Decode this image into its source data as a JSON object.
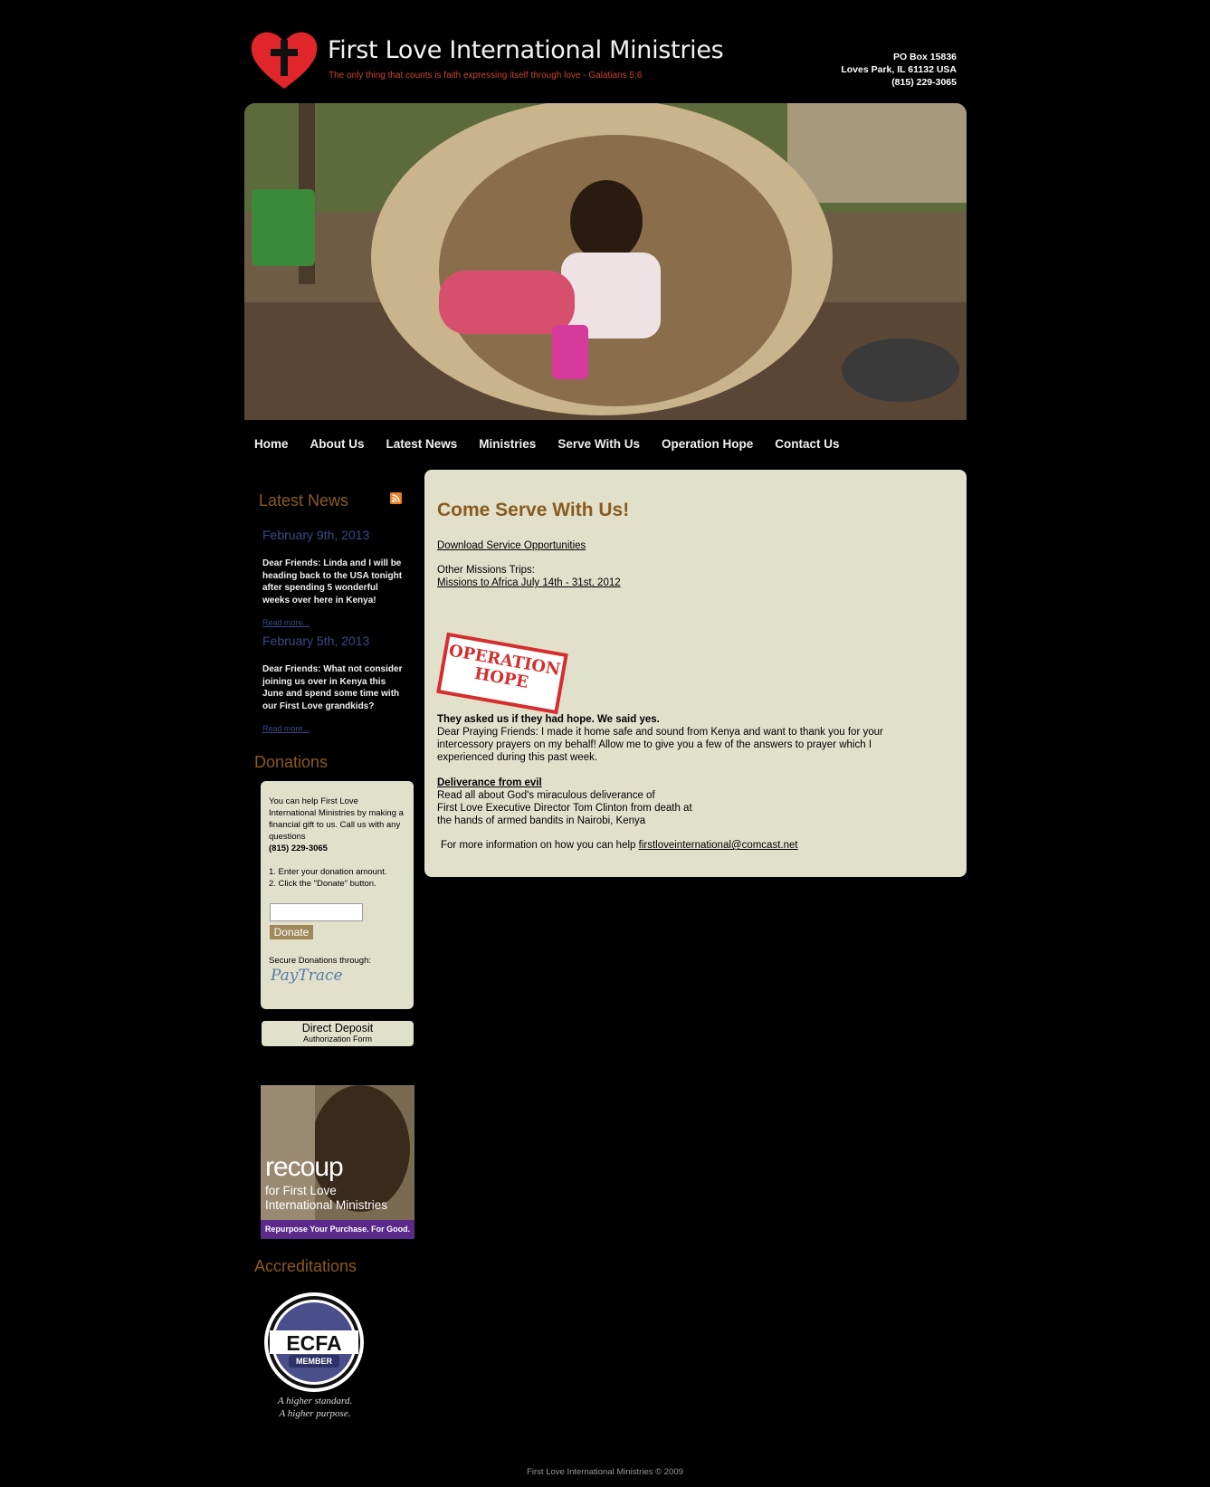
{
  "header": {
    "title": "First Love International Ministries",
    "tagline": "The only thing that counts is faith expressing itself through love - Galatians 5:6",
    "address": [
      "PO Box 15836",
      "Loves Park, IL 61132 USA",
      "(815) 229-3065"
    ]
  },
  "nav": {
    "items": [
      "Home",
      "About Us",
      "Latest News",
      "Ministries",
      "Serve With Us",
      "Operation Hope",
      "Contact Us"
    ]
  },
  "sidebar": {
    "latest_news_heading": "Latest News",
    "news": [
      {
        "date": "February 9th, 2013",
        "text": "Dear Friends: Linda and I will be heading back to the USA tonight after spending 5 wonderful weeks over here in Kenya!",
        "more": "Read more..."
      },
      {
        "date": "February 5th, 2013",
        "text": "Dear Friends: What not consider joining us over in Kenya this June and spend some time with our First Love grandkids?",
        "more": "Read more..."
      }
    ],
    "donations_heading": "Donations",
    "donation_text": "You can help First Love International Ministries by making a financial gift to us. Call us with any questions",
    "donation_phone": "(815) 229-3065",
    "donation_step1": "1. Enter your donation amount.",
    "donation_step2": "2. Click the \"Donate\" button.",
    "donate_button": "Donate",
    "secure_text": "Secure Donations through:",
    "paytrace": "PayTrace",
    "direct_deposit_title": "Direct Deposit",
    "direct_deposit_sub": "Authorization Form",
    "recoup_word": "recoup",
    "recoup_sub1": "for First Love",
    "recoup_sub2": "International Ministries",
    "recoup_bar": "Repurpose Your Purchase. For Good.",
    "accreditations_heading": "Accreditations",
    "ecfa_name": "ECFA",
    "ecfa_member": "MEMBER",
    "ecfa_tag1": "A higher standard.",
    "ecfa_tag2": "A higher purpose."
  },
  "main": {
    "title": "Come Serve With Us!",
    "download_link": "Download Service Opportunities",
    "other_trips": "Other Missions Trips:",
    "africa_link": "Missions to Africa July 14th - 31st, 2012",
    "op_hope_line1": "OPERATION",
    "op_hope_line2": "HOPE",
    "hope_heading": "They asked us if they had hope.  We said yes.",
    "hope_body": [
      "Dear Praying Friends:  I made it home safe and sound from Kenya and want to thank you for your",
      "intercessory prayers on my behalf!  Allow me to  give you a few of the answers to prayer which I",
      "experienced during this past week."
    ],
    "deliverance_link": "Deliverance from evil",
    "deliverance_body": [
      "Read all about God's miraculous deliverance of",
      "First Love Executive Director Tom Clinton from death at",
      "the hands of armed bandits in Nairobi, Kenya"
    ],
    "more_info": "For more information on how you can help",
    "email": "firstloveinternational@comcast.net"
  },
  "footer": {
    "text": "First Love International Ministries © 2009"
  },
  "colors": {
    "accent_brown": "#8a5a1e",
    "panel_bg": "#e1e0cb",
    "news_date_blue": "#3a4a8a",
    "tagline_red": "#c7452e"
  }
}
